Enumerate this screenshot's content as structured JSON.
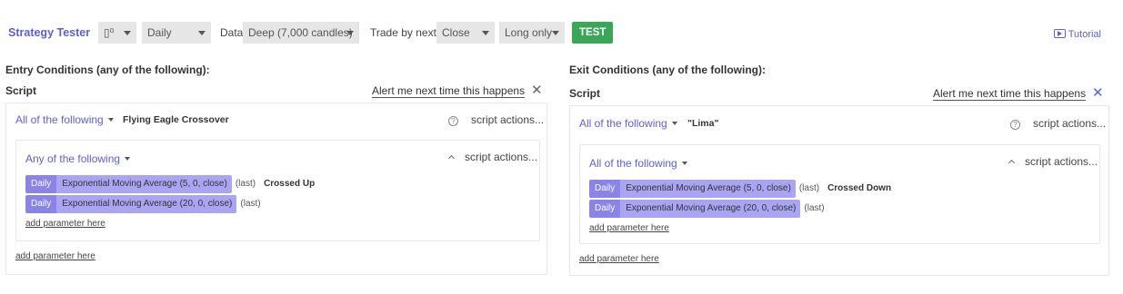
{
  "toolbar": {
    "title": "Strategy Tester",
    "chart_icon_label": "▯⁰",
    "timeframe": "Daily",
    "data_label": "Data",
    "data_value": "Deep (7,000 candles)",
    "trade_by_label": "Trade by next",
    "trade_by_value": "Close",
    "direction": "Long only",
    "test_button": "TEST",
    "tutorial": "Tutorial"
  },
  "entry": {
    "title": "Entry Conditions (any of the following):",
    "script_label": "Script",
    "alert_link": "Alert me next time this happens",
    "outer_mode": "All of the following",
    "script_name": "Flying Eagle Crossover",
    "outer_actions": "script actions...",
    "inner_mode": "Any of the following",
    "inner_actions": "script actions...",
    "conditions": [
      {
        "timeframe": "Daily",
        "indicator": "Exponential Moving Average (5, 0, close)",
        "last": "(last)",
        "op": "Crossed Up"
      },
      {
        "timeframe": "Daily",
        "indicator": "Exponential Moving Average (20, 0, close)",
        "last": "(last)",
        "op": ""
      }
    ],
    "inner_add_param": "add parameter here",
    "outer_add_param": "add parameter here"
  },
  "exit": {
    "title": "Exit Conditions (any of the following):",
    "script_label": "Script",
    "alert_link": "Alert me next time this happens",
    "outer_mode": "All of the following",
    "script_name": "\"Lima\"",
    "outer_actions": "script actions...",
    "inner_mode": "All of the following",
    "inner_actions": "script actions...",
    "conditions": [
      {
        "timeframe": "Daily",
        "indicator": "Exponential Moving Average (5, 0, close)",
        "last": "(last)",
        "op": "Crossed Down"
      },
      {
        "timeframe": "Daily",
        "indicator": "Exponential Moving Average (20, 0, close)",
        "last": "(last)",
        "op": ""
      }
    ],
    "inner_add_param": "add parameter here",
    "outer_add_param": "add parameter here"
  },
  "colors": {
    "accent": "#5c5fd6",
    "test_green": "#3aa657",
    "chip_dark": "#8a83e8",
    "chip_light": "#aaa5f3",
    "close_entry": "#666666",
    "close_exit": "#5c5fd6"
  }
}
